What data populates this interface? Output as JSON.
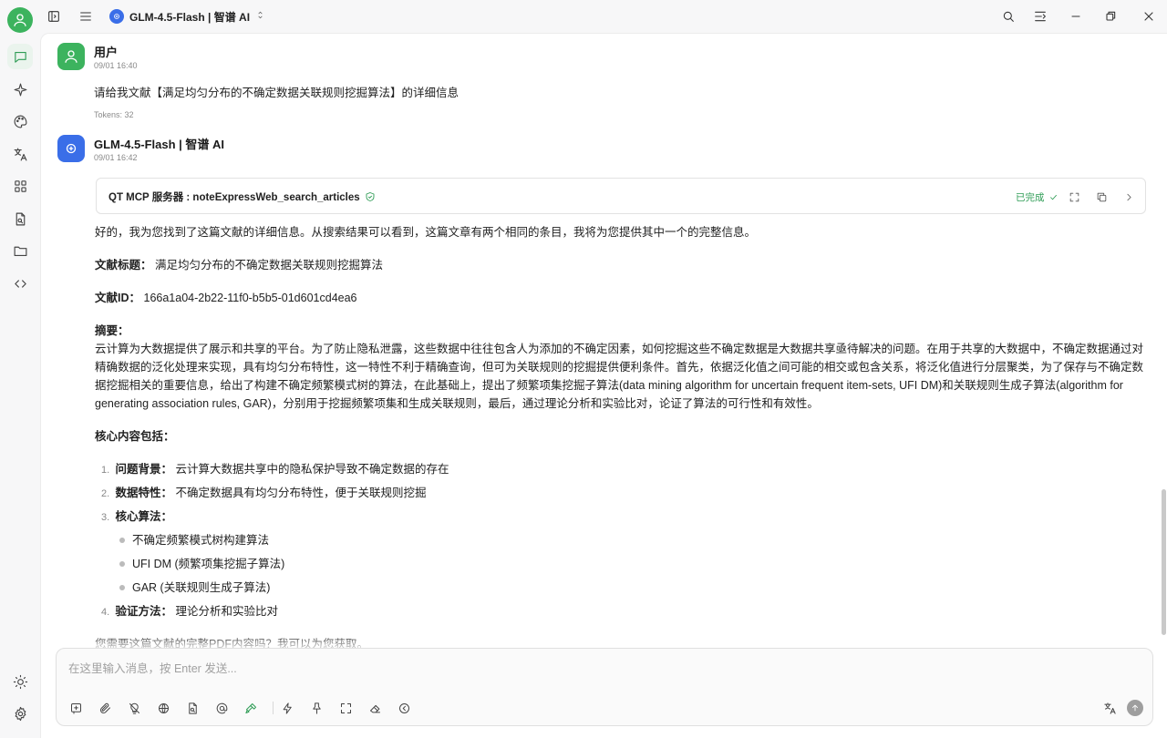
{
  "topbar": {
    "model_name": "GLM-4.5-Flash | 智谱 AI"
  },
  "user_msg": {
    "name": "用户",
    "time": "09/01 16:40",
    "text": "请给我文献【满足均匀分布的不确定数据关联规则挖掘算法】的详细信息",
    "tokens": "Tokens: 32"
  },
  "ai_msg": {
    "name": "GLM-4.5-Flash | 智谱 AI",
    "time": "09/01 16:42",
    "tool": {
      "label": "QT MCP 服务器 : noteExpressWeb_search_articles",
      "status": "已完成"
    },
    "intro": "好的，我为您找到了这篇文献的详细信息。从搜索结果可以看到，这篇文章有两个相同的条目，我将为您提供其中一个的完整信息。",
    "title_label": "文献标题：",
    "title_value": "满足均匀分布的不确定数据关联规则挖掘算法",
    "id_label": "文献ID：",
    "id_value": "166a1a04-2b22-11f0-b5b5-01d601cd4ea6",
    "abstract_label": "摘要：",
    "abstract": "云计算为大数据提供了展示和共享的平台。为了防止隐私泄露，这些数据中往往包含人为添加的不确定因素，如何挖掘这些不确定数据是大数据共享亟待解决的问题。在用于共享的大数据中，不确定数据通过对精确数据的泛化处理来实现，具有均匀分布特性，这一特性不利于精确查询，但可为关联规则的挖掘提供便利条件。首先，依据泛化值之间可能的相交或包含关系，将泛化值进行分层聚类，为了保存与不确定数据挖掘相关的重要信息，给出了构建不确定频繁模式树的算法，在此基础上，提出了频繁项集挖掘子算法(data mining algorithm for uncertain frequent item-sets, UFI DM)和关联规则生成子算法(algorithm for generating association rules, GAR)，分别用于挖掘频繁项集和生成关联规则，最后，通过理论分析和实验比对，论证了算法的可行性和有效性。",
    "core_label": "核心内容包括：",
    "items": [
      {
        "num": "1.",
        "label": "问题背景：",
        "value": "云计算大数据共享中的隐私保护导致不确定数据的存在"
      },
      {
        "num": "2.",
        "label": "数据特性：",
        "value": "不确定数据具有均匀分布特性，便于关联规则挖掘"
      },
      {
        "num": "3.",
        "label": "核心算法：",
        "value": ""
      },
      {
        "num": "4.",
        "label": "验证方法：",
        "value": "理论分析和实验比对"
      }
    ],
    "sub_items": [
      "不确定频繁模式树构建算法",
      "UFI DM (频繁项集挖掘子算法)",
      "GAR (关联规则生成子算法)"
    ],
    "closing": "您需要这篇文献的完整PDF内容吗？我可以为您获取。"
  },
  "input": {
    "placeholder": "在这里输入消息，按 Enter 发送..."
  },
  "colors": {
    "accent": "#2e9c55",
    "model_blue": "#3a6ee8"
  }
}
